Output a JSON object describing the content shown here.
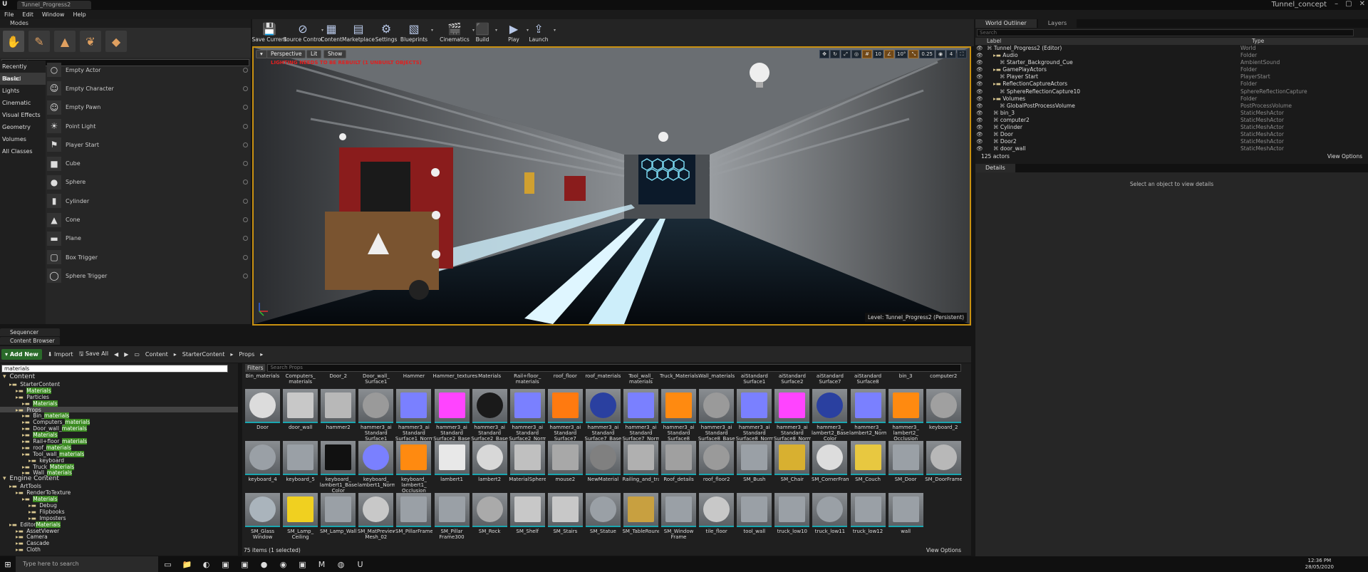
{
  "app": {
    "doc_tab": "Tunnel_Progress2",
    "project": "Tunnel_concept",
    "menu": [
      "File",
      "Edit",
      "Window",
      "Help"
    ]
  },
  "modes": {
    "title": "Modes",
    "search_placeholder": "Search Classes",
    "categories": [
      "Recently Placed",
      "Basic",
      "Lights",
      "Cinematic",
      "Visual Effects",
      "Geometry",
      "Volumes",
      "All Classes"
    ],
    "items": [
      "Empty Actor",
      "Empty Character",
      "Empty Pawn",
      "Point Light",
      "Player Start",
      "Cube",
      "Sphere",
      "Cylinder",
      "Cone",
      "Plane",
      "Box Trigger",
      "Sphere Trigger"
    ]
  },
  "toolbar": {
    "items": [
      "Save Current",
      "Source Control",
      "Content",
      "Marketplace",
      "Settings",
      "Blueprints",
      "Cinematics",
      "Build",
      "Play",
      "Launch"
    ]
  },
  "viewport": {
    "perspective": "Perspective",
    "lit": "Lit",
    "show": "Show",
    "warning": "LIGHTING NEEDS TO BE REBUILT (1 UNBUILT OBJECTS)",
    "level_label": "Level:  Tunnel_Progress2 (Persistent)",
    "snap_values": [
      "10",
      "10°",
      "0.25",
      "4"
    ]
  },
  "outliner": {
    "tab": "World Outliner",
    "tab2": "Layers",
    "search_placeholder": "Search",
    "col_label": "Label",
    "col_type": "Type",
    "rows": [
      {
        "label": "Tunnel_Progress2 (Editor)",
        "type": "World"
      },
      {
        "label": "Audio",
        "type": "Folder"
      },
      {
        "label": "Starter_Background_Cue",
        "type": "AmbientSound"
      },
      {
        "label": "GamePlayActors",
        "type": "Folder"
      },
      {
        "label": "Player Start",
        "type": "PlayerStart"
      },
      {
        "label": "ReflectionCaptureActors",
        "type": "Folder"
      },
      {
        "label": "SphereReflectionCapture10",
        "type": "SphereReflectionCapture"
      },
      {
        "label": "Volumes",
        "type": "Folder"
      },
      {
        "label": "GlobalPostProcessVolume",
        "type": "PostProcessVolume"
      },
      {
        "label": "bin_3",
        "type": "StaticMeshActor"
      },
      {
        "label": "computer2",
        "type": "StaticMeshActor"
      },
      {
        "label": "Cylinder",
        "type": "StaticMeshActor"
      },
      {
        "label": "Door",
        "type": "StaticMeshActor"
      },
      {
        "label": "Door2",
        "type": "StaticMeshActor"
      },
      {
        "label": "door_wall",
        "type": "StaticMeshActor"
      }
    ],
    "count": "125 actors",
    "view_options": "View Options"
  },
  "details": {
    "tab": "Details",
    "empty": "Select an object to view details"
  },
  "bottom_tabs": [
    "Sequencer",
    "Content Browser"
  ],
  "content_browser": {
    "add_new": "Add New",
    "import": "Import",
    "save_all": "Save All",
    "path": [
      "Content",
      "StarterContent",
      "Props"
    ],
    "search_value": "materials",
    "asset_search_placeholder": "Search Props",
    "filters": "Filters",
    "tree": [
      {
        "t": "Content",
        "d": 0,
        "big": true
      },
      {
        "t": "StarterContent",
        "d": 1
      },
      {
        "t": "Materials",
        "d": 2,
        "hl": "Materials"
      },
      {
        "t": "Particles",
        "d": 2
      },
      {
        "t": "Materials",
        "d": 3,
        "hl": "Materials"
      },
      {
        "t": "Props",
        "d": 2,
        "sel": true
      },
      {
        "t": "Bin_materials",
        "d": 3,
        "hl": "materials"
      },
      {
        "t": "Computers_materials",
        "d": 3,
        "hl": "materials"
      },
      {
        "t": "Door_wall_materials",
        "d": 3,
        "hl": "materials"
      },
      {
        "t": "Materials",
        "d": 3,
        "hl": "Materials"
      },
      {
        "t": "Rail+floor_materials",
        "d": 3,
        "hl": "materials"
      },
      {
        "t": "roof_materials",
        "d": 3,
        "hl": "materials"
      },
      {
        "t": "Tool_wall_materials",
        "d": 3,
        "hl": "materials"
      },
      {
        "t": "keyboard",
        "d": 4
      },
      {
        "t": "Truck_Materials",
        "d": 3,
        "hl": "Materials"
      },
      {
        "t": "Wall_materials",
        "d": 3,
        "hl": "materials"
      },
      {
        "t": "Engine Content",
        "d": 0,
        "big": true
      },
      {
        "t": "ArtTools",
        "d": 1
      },
      {
        "t": "RenderToTexture",
        "d": 2
      },
      {
        "t": "Materials",
        "d": 3,
        "hl": "Materials"
      },
      {
        "t": "Debug",
        "d": 4
      },
      {
        "t": "Flipbooks",
        "d": 4
      },
      {
        "t": "Imposters",
        "d": 4
      },
      {
        "t": "EditorMaterials",
        "d": 1,
        "hl": "Materials"
      },
      {
        "t": "AssetViewer",
        "d": 2
      },
      {
        "t": "Camera",
        "d": 2
      },
      {
        "t": "Cascade",
        "d": 2
      },
      {
        "t": "Cloth",
        "d": 2
      }
    ],
    "folders": [
      "Bin_materials",
      "Computers_ materials",
      "Door_2",
      "Door_wall_ Surface1",
      "Hammer",
      "Hammer_textures",
      "Materials",
      "Rail+floor_ materials",
      "roof_floor",
      "roof_materials",
      "Tool_wall_ materials",
      "Truck_Materials",
      "Wall_materials",
      "aiStandard Surface1",
      "aiStandard Surface2",
      "aiStandard Surface7",
      "aiStandard Surface8",
      "bin_3",
      "computer2"
    ],
    "row1": [
      "Door",
      "door_wall",
      "hammer2",
      "hammer3_ai Standard Surface1",
      "hammer3_ai Standard Surface1_Normal",
      "hammer3_ai Standard Surface2_Base",
      "hammer3_ai Standard Surface2_Base",
      "hammer3_ai Standard Surface2_Normal",
      "hammer3_ai Standard Surface7",
      "hammer3_ai Standard Surface7_Base",
      "hammer3_ai Standard Surface7_Normal",
      "hammer3_ai Standard Surface8",
      "hammer3_ai Standard Surface8_Base",
      "hammer3_ai Standard Surface8_Normal",
      "hammer3_ai Standard Surface8_Normal",
      "hammer3_ lambert2_Base Color",
      "hammer3_ lambert2_Normal",
      "hammer3_ lambert2_ Occlusion",
      "keyboard_2"
    ],
    "row2": [
      "keyboard_4",
      "keyboard_5",
      "keyboard_ lambert1_Base Color",
      "keyboard_ lambert1_Normal",
      "keyboard_ lambert1_ Occlusion",
      "lambert1",
      "lambert2",
      "MaterialSphere",
      "mouse2",
      "NewMaterial",
      "Railing_and_trail",
      "Roof_details",
      "roof_floor2",
      "SM_Bush",
      "SM_Chair",
      "SM_CornerFrame",
      "SM_Couch",
      "SM_Door",
      "SM_DoorFrame"
    ],
    "row3": [
      "SM_Glass Window",
      "SM_Lamp_ Ceiling",
      "SM_Lamp_Wall",
      "SM_MatPreview Mesh_02",
      "SM_PillarFrame",
      "SM_Pillar Frame300",
      "SM_Rock",
      "SM_Shelf",
      "SM_Stairs",
      "SM_Statue",
      "SM_TableRound",
      "SM_Window Frame",
      "tile_floor",
      "tool_wall",
      "truck_low10",
      "truck_low11",
      "truck_low12",
      "wall"
    ],
    "count": "75 items (1 selected)",
    "view_options": "View Options"
  },
  "taskbar": {
    "search": "Type here to search",
    "time": "12:36 PM",
    "date": "28/05/2020"
  },
  "colors": {
    "viewport_border": "#c89010",
    "add_new": "#2a6a2a",
    "highlight": "#3a8a20",
    "asset_bar": "#1aa6b0"
  }
}
